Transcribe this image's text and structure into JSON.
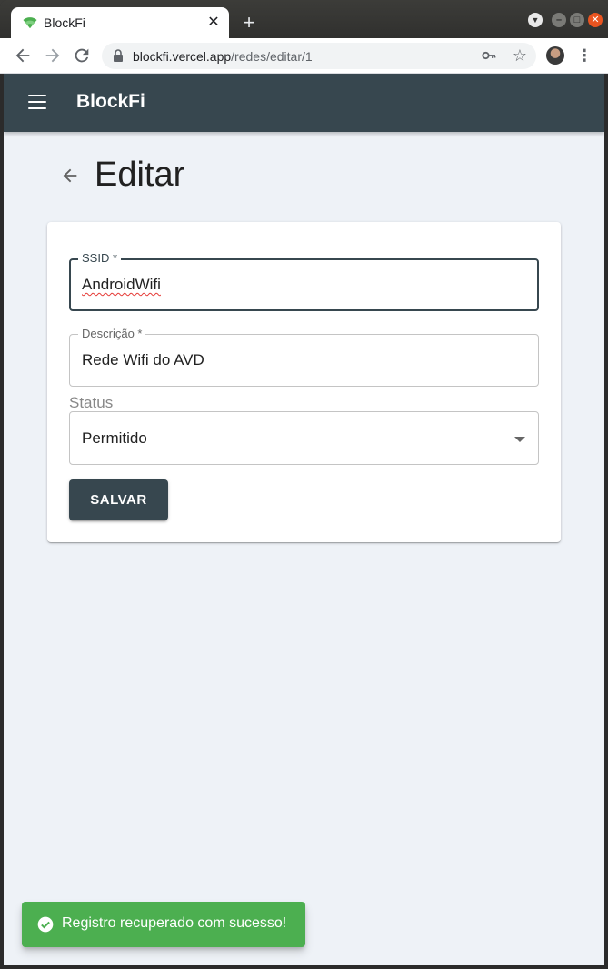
{
  "browser": {
    "tab_title": "BlockFi",
    "tab_close": "✕",
    "new_tab": "+",
    "url_host": "blockfi.vercel.app",
    "url_path": "/redes/editar/1",
    "star": "☆",
    "menu": "⋮"
  },
  "app": {
    "title": "BlockFi",
    "accent_color": "#37474f"
  },
  "page": {
    "title": "Editar"
  },
  "form": {
    "ssid": {
      "label": "SSID *",
      "value": "AndroidWifi"
    },
    "description": {
      "label": "Descrição *",
      "value": "Rede Wifi do AVD"
    },
    "status": {
      "label": "Status",
      "value": "Permitido"
    },
    "save_label": "SALVAR"
  },
  "snackbar": {
    "message": "Registro recuperado com sucesso!",
    "color": "#4caf50"
  }
}
